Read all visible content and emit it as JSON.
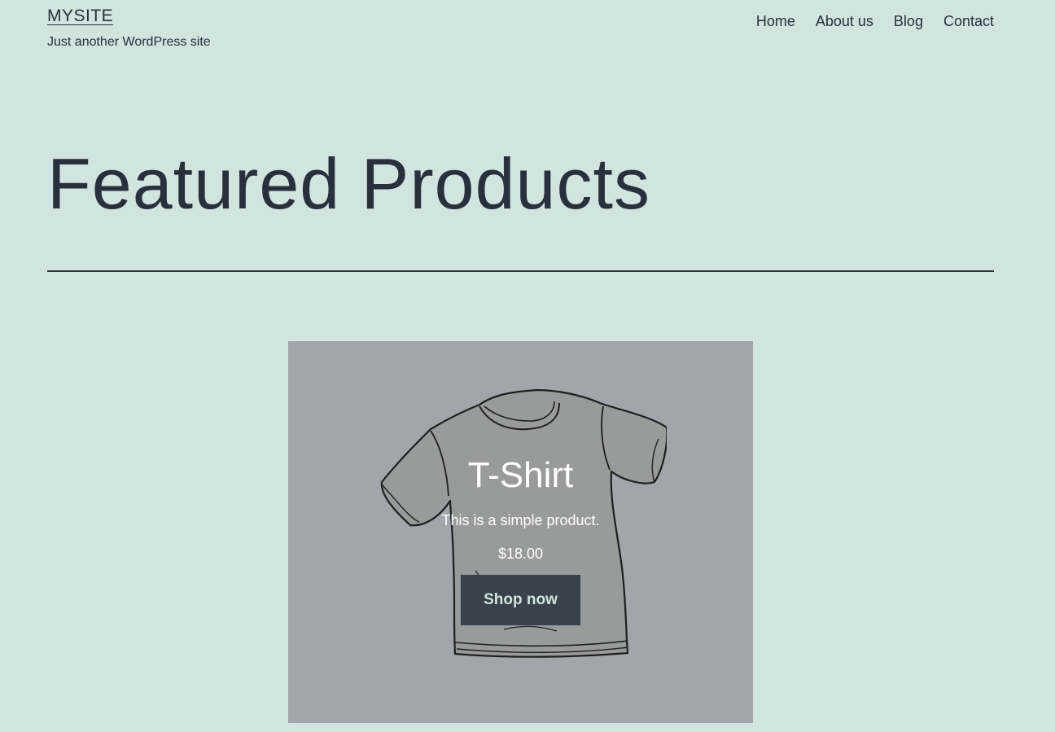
{
  "header": {
    "site_title": "MYSITE",
    "tagline": "Just another WordPress site"
  },
  "nav": {
    "items": [
      {
        "label": "Home"
      },
      {
        "label": "About us"
      },
      {
        "label": "Blog"
      },
      {
        "label": "Contact"
      }
    ]
  },
  "main": {
    "page_title": "Featured Products"
  },
  "product": {
    "name": "T-Shirt",
    "description": "This is a simple product.",
    "price": "$18.00",
    "button_label": "Shop now",
    "image_icon": "tshirt-illustration"
  },
  "colors": {
    "background": "#d1e4dd",
    "text": "#28303d",
    "cover_overlay": "#a2a6aa",
    "button_bg": "#39414d",
    "button_text": "#d1e4dd"
  }
}
